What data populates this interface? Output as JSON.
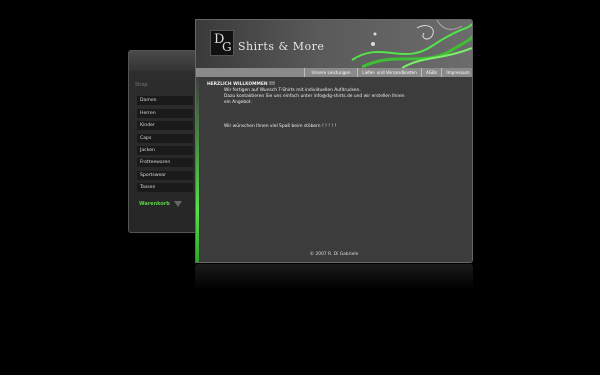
{
  "sidebar": {
    "header": "Shop",
    "items": [
      {
        "label": "Damen"
      },
      {
        "label": "Herren"
      },
      {
        "label": "Kinder"
      },
      {
        "label": "Caps"
      },
      {
        "label": "Jacken"
      },
      {
        "label": "Frotteewaren"
      },
      {
        "label": "Sportswear"
      },
      {
        "label": "Tassen"
      }
    ],
    "cart_label": "Warenkorb"
  },
  "header": {
    "logo_letters": [
      "D",
      "G"
    ],
    "brand": "Shirts & More"
  },
  "nav": {
    "items": [
      {
        "label": "Unsere Leistungen"
      },
      {
        "label": "Liefer- und Versandkosten"
      },
      {
        "label": "AGBs"
      },
      {
        "label": "Impressum"
      }
    ]
  },
  "content": {
    "title": "HERZLICH WILLKOMMEN !!!",
    "line1": "Wir fertigen auf Wunsch T-Shirts mit individuellen Aufdrucken.",
    "line2": "Dazu kontaktieren Sie uns einfach unter info@dg-shirts.de und wir erstellen Ihnen",
    "line3": "ein Angebot.",
    "line4": "Wir wünschen Ihnen viel Spaß beim stöbern ! ! ! ! !"
  },
  "footer": {
    "text": "© 2007 R. Di Gabriele"
  },
  "colors": {
    "accent_green": "#55e24a",
    "background": "#000000",
    "panel": "#3c3c3c"
  }
}
